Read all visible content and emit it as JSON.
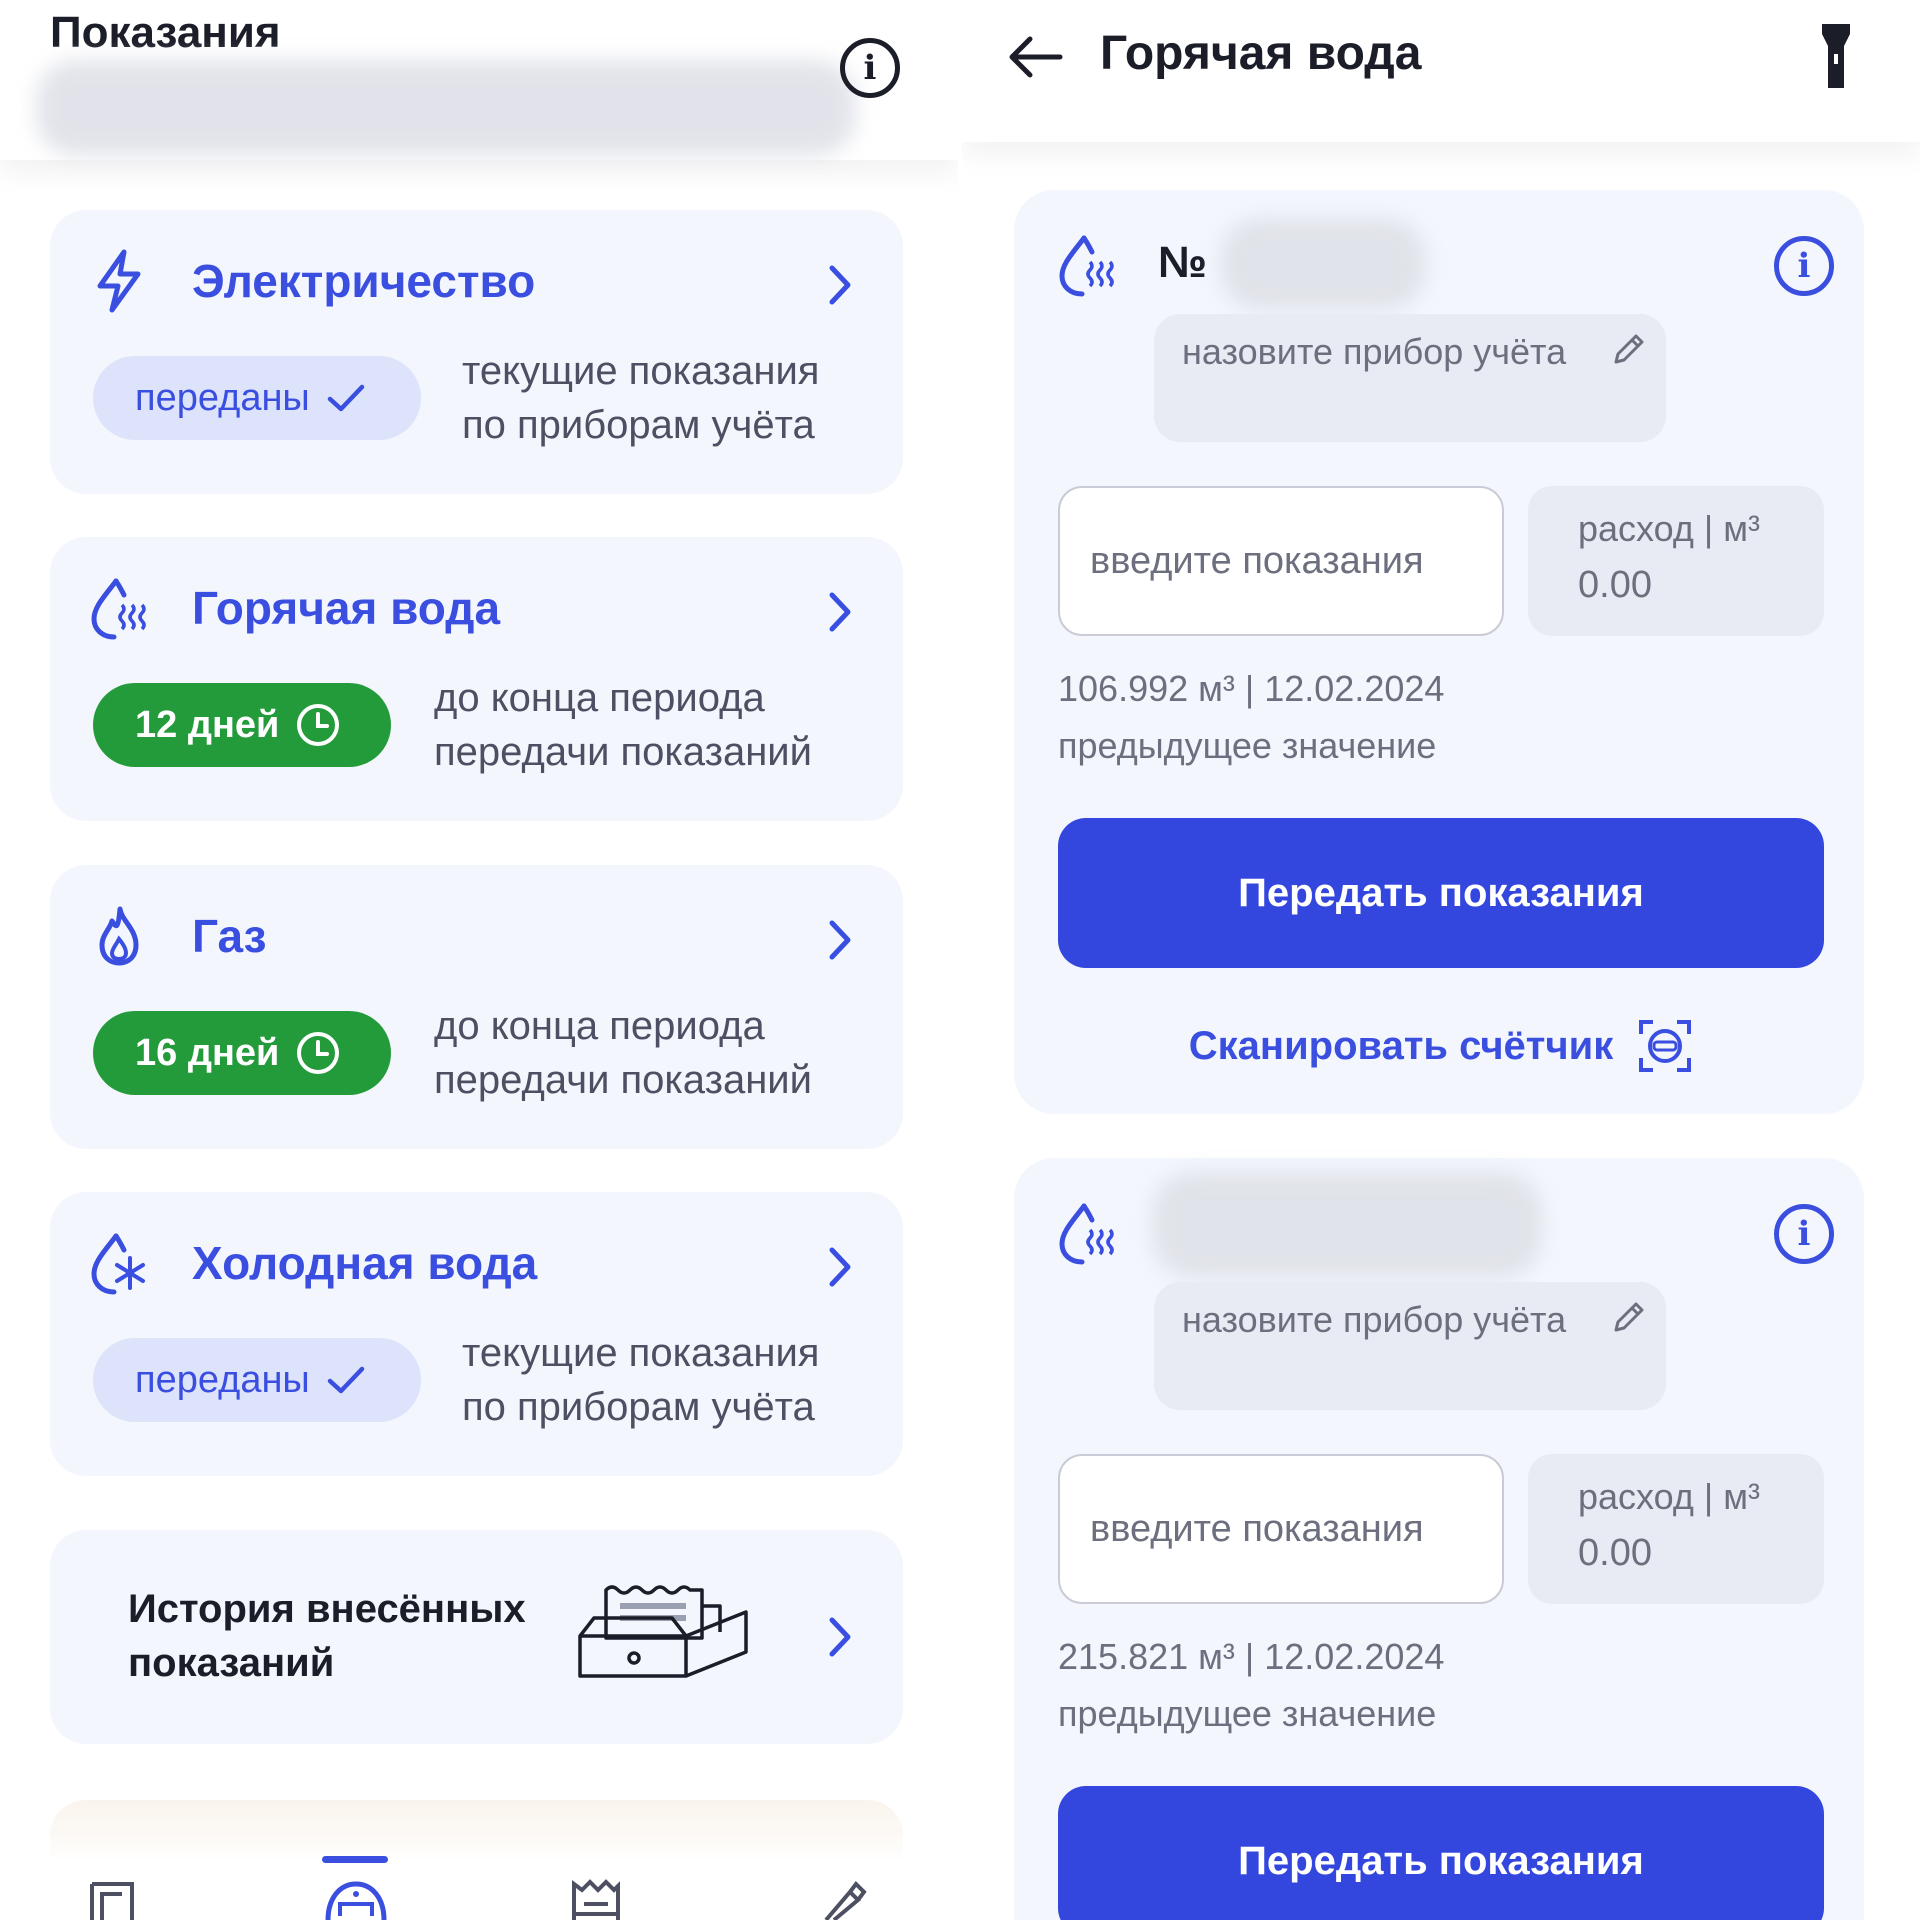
{
  "left": {
    "title": "Показания",
    "cards": [
      {
        "title": "Электричество",
        "status": "передано",
        "status_label": "переданы",
        "desc": [
          "текущие показания",
          "по приборам учёта"
        ]
      },
      {
        "title": "Горячая вода",
        "status_label": "12 дней",
        "desc": [
          "до конца периода",
          "передачи показаний"
        ]
      },
      {
        "title": "Газ",
        "status_label": "16 дней",
        "desc": [
          "до конца периода",
          "передачи показаний"
        ]
      },
      {
        "title": "Холодная вода",
        "status_label": "переданы",
        "desc": [
          "текущие показания",
          "по приборам учёта"
        ]
      }
    ],
    "history": {
      "title": "История внесённых показаний"
    }
  },
  "right": {
    "title": "Горячая вода",
    "meters": [
      {
        "number_prefix": "№",
        "name_placeholder": "назовите прибор учёта",
        "input_placeholder": "введите показания",
        "usage_label": "расход | м³",
        "usage_value": "0.00",
        "prev_value": "106.992 м³ | 12.02.2024",
        "prev_label": "предыдущее значение",
        "submit_label": "Передать показания",
        "scan_label": "Сканировать счётчик"
      },
      {
        "number_prefix": "",
        "name_placeholder": "назовите прибор учёта",
        "input_placeholder": "введите показания",
        "usage_label": "расход | м³",
        "usage_value": "0.00",
        "prev_value": "215.821 м³ | 12.02.2024",
        "prev_label": "предыдущее значение",
        "submit_label": "Передать показания"
      }
    ]
  },
  "colors": {
    "accent": "#3a4fe0",
    "button": "#3346de",
    "success": "#239b3a",
    "card_bg": "#f3f6fd"
  },
  "icons": [
    "info-icon",
    "lightning-icon",
    "hot-water-icon",
    "gas-flame-icon",
    "cold-water-icon",
    "chevron-right-icon",
    "check-icon",
    "clock-icon",
    "archive-box-icon",
    "back-arrow-icon",
    "flashlight-icon",
    "pencil-icon",
    "scan-icon"
  ]
}
